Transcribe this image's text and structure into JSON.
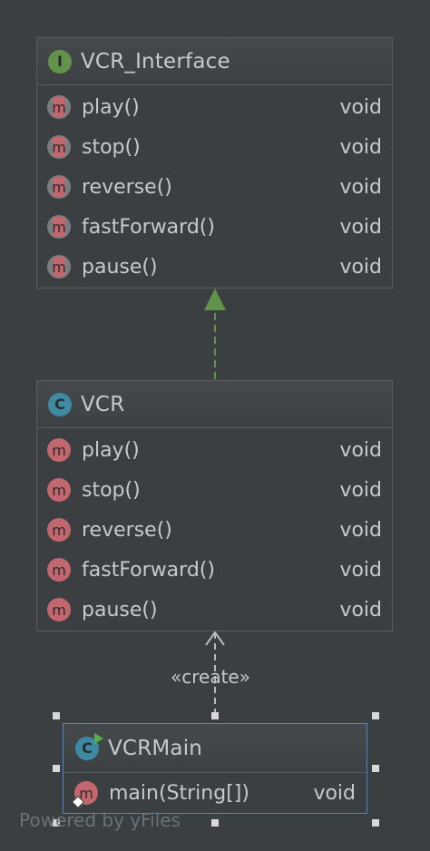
{
  "classes": [
    {
      "name": "VCR_Interface",
      "kind_icon": "I",
      "kind": "interface",
      "methods": [
        {
          "name": "play()",
          "type": "void"
        },
        {
          "name": "stop()",
          "type": "void"
        },
        {
          "name": "reverse()",
          "type": "void"
        },
        {
          "name": "fastForward()",
          "type": "void"
        },
        {
          "name": "pause()",
          "type": "void"
        }
      ]
    },
    {
      "name": "VCR",
      "kind_icon": "C",
      "kind": "class",
      "methods": [
        {
          "name": "play()",
          "type": "void"
        },
        {
          "name": "stop()",
          "type": "void"
        },
        {
          "name": "reverse()",
          "type": "void"
        },
        {
          "name": "fastForward()",
          "type": "void"
        },
        {
          "name": "pause()",
          "type": "void"
        }
      ]
    },
    {
      "name": "VCRMain",
      "kind_icon": "C",
      "kind": "class",
      "methods": [
        {
          "name": "main(String[])",
          "type": "void"
        }
      ]
    }
  ],
  "method_icon": "m",
  "edges": [
    {
      "from": "VCR",
      "to": "VCR_Interface",
      "kind": "realization",
      "color": "#62934b"
    },
    {
      "from": "VCRMain",
      "to": "VCR",
      "kind": "dependency",
      "label": "«create»",
      "color": "#bbbbbb"
    }
  ],
  "watermark": "Powered by yFiles",
  "colors": {
    "background": "#3c3f41",
    "interface_icon": "#62934b",
    "class_icon": "#3f8aa3",
    "method_icon": "#c3676f",
    "selection": "#4a88c7"
  }
}
